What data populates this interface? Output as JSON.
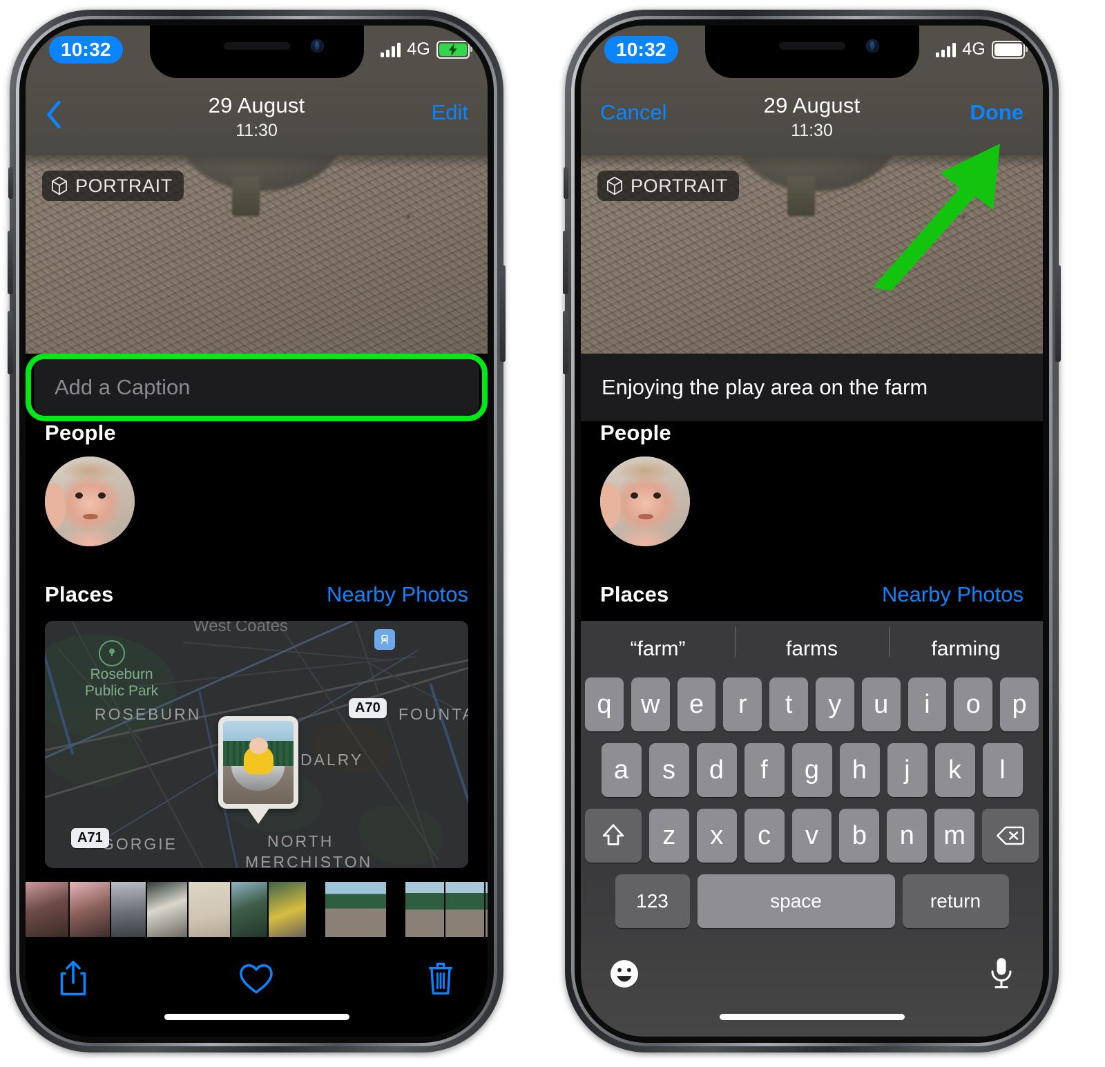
{
  "status": {
    "time": "10:32",
    "network": "4G",
    "signal_bars": 4,
    "battery_left_state": "charging",
    "battery_right_state": "full"
  },
  "nav": {
    "title": "29 August",
    "subtitle": "11:30",
    "left_back_icon": "chevron-left-icon",
    "left_edit_label": "Edit",
    "left_right_action": "Edit",
    "right_cancel_label": "Cancel",
    "right_done_label": "Done"
  },
  "photo": {
    "badge_label": "PORTRAIT",
    "badge_icon": "cube-icon"
  },
  "caption": {
    "placeholder": "Add a Caption",
    "value": "Enjoying the play area on the farm"
  },
  "sections": {
    "people_title": "People",
    "places_title": "Places",
    "nearby_photos_label": "Nearby Photos"
  },
  "map": {
    "park_label": "Roseburn\nPublic Park",
    "park_label_line1": "Roseburn",
    "park_label_line2": "Public Park",
    "labels": [
      "West Coates",
      "ROSEBURN",
      "DALRY",
      "FOUNTAIN",
      "GORGIE",
      "NORTH",
      "MERCHISTON"
    ],
    "road_shields": [
      "A70",
      "A71"
    ],
    "train_icon": "train-station-icon",
    "park_icon": "park-tree-icon",
    "pin_icon": "photo-pin-marker"
  },
  "toolbar": {
    "share_label": "share-icon",
    "favorite_label": "heart-icon",
    "delete_label": "trash-icon"
  },
  "keyboard": {
    "suggestions": [
      "“farm”",
      "farms",
      "farming"
    ],
    "row1": [
      "q",
      "w",
      "e",
      "r",
      "t",
      "y",
      "u",
      "i",
      "o",
      "p"
    ],
    "row2": [
      "a",
      "s",
      "d",
      "f",
      "g",
      "h",
      "j",
      "k",
      "l"
    ],
    "row3": [
      "z",
      "x",
      "c",
      "v",
      "b",
      "n",
      "m"
    ],
    "shift_icon": "shift-up-arrow-icon",
    "backspace_icon": "backspace-delete-icon",
    "numbers_label": "123",
    "space_label": "space",
    "return_label": "return",
    "emoji_icon": "emoji-smiley-icon",
    "dictation_icon": "microphone-icon"
  },
  "annotation": {
    "highlight_color": "#00e818",
    "arrow_color": "#16c612",
    "accent_blue": "#0a84ff"
  }
}
